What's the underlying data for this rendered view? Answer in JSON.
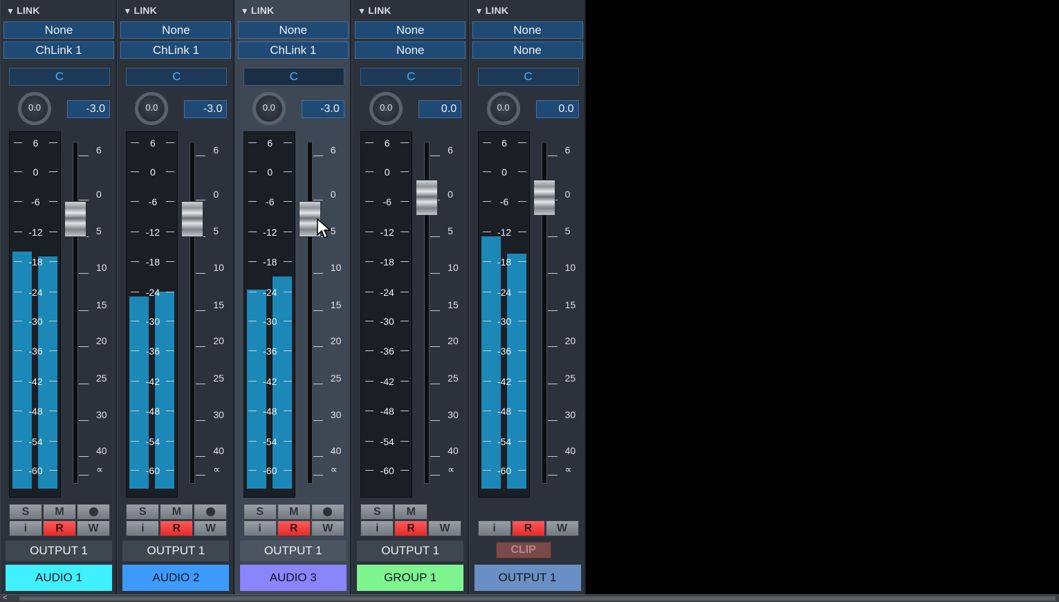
{
  "link_label": "LINK",
  "meter_scale": [
    "6",
    "0",
    "-6",
    "-12",
    "-18",
    "-24",
    "-30",
    "-36",
    "-42",
    "-48",
    "-54",
    "-60"
  ],
  "fader_scale": [
    "6",
    "0",
    "5",
    "10",
    "15",
    "20",
    "25",
    "30",
    "40",
    "∝"
  ],
  "buttons": {
    "solo": "S",
    "mute": "M",
    "info": "i",
    "read": "R",
    "write": "W"
  },
  "clip_label": "CLIP",
  "channels": [
    {
      "name": "AUDIO 1",
      "color": "#3ff0ff",
      "link1": "None",
      "link2": "ChLink 1",
      "pan": "C",
      "knob": "0.0",
      "volume": "-3.0",
      "meter_level_db": [
        -17,
        -18
      ],
      "fader_db": -3.0,
      "output": "OUTPUT 1",
      "has_record": true,
      "selected": false
    },
    {
      "name": "AUDIO 2",
      "color": "#3d9bff",
      "link1": "None",
      "link2": "ChLink 1",
      "pan": "C",
      "knob": "0.0",
      "volume": "-3.0",
      "meter_level_db": [
        -26,
        -25
      ],
      "fader_db": -3.0,
      "output": "OUTPUT 1",
      "has_record": true,
      "selected": false
    },
    {
      "name": "AUDIO 3",
      "color": "#8b84ff",
      "link1": "None",
      "link2": "ChLink 1",
      "pan": "C",
      "knob": "0.0",
      "volume": "-3.0",
      "meter_level_db": [
        -24.5,
        -22
      ],
      "fader_db": -3.0,
      "output": "OUTPUT 1",
      "has_record": true,
      "selected": true
    },
    {
      "name": "GROUP 1",
      "color": "#7ff58f",
      "link1": "None",
      "link2": "None",
      "pan": "C",
      "knob": "0.0",
      "volume": "0.0",
      "meter_level_db": null,
      "fader_db": 0.0,
      "output": "OUTPUT 1",
      "has_record": false,
      "selected": false
    },
    {
      "name": "OUTPUT 1",
      "color": "#6a8fc4",
      "link1": "None",
      "link2": "None",
      "pan": "C",
      "knob": "0.0",
      "volume": "0.0",
      "meter_level_db": [
        -14,
        -17.5
      ],
      "fader_db": 0.0,
      "output": null,
      "has_record": false,
      "selected": false,
      "clip": true
    }
  ]
}
